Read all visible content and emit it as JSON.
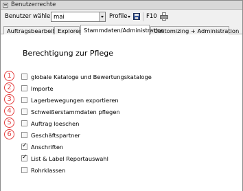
{
  "window": {
    "title": "Benutzerrechte"
  },
  "toolbar": {
    "user_label": "Benutzer wählen:",
    "user_value": "mai",
    "profile_label": "Profile",
    "f10_label": "F10"
  },
  "tabs": [
    {
      "label": "Auftragsbearbeitung",
      "active": false
    },
    {
      "label": "Explorer",
      "active": false
    },
    {
      "label": "Stammdaten/Administration",
      "active": true
    },
    {
      "label": "Customizing + Administration",
      "active": false
    }
  ],
  "section": {
    "title": "Berechtigung zur Pflege"
  },
  "annotations": [
    "1",
    "2",
    "3",
    "4",
    "5",
    "6"
  ],
  "permissions": [
    {
      "label": "globale Kataloge und Bewertungskataloge",
      "checked": false
    },
    {
      "label": "Importe",
      "checked": false
    },
    {
      "label": "Lagerbewegungen exportieren",
      "checked": false
    },
    {
      "label": "Schweißerstammdaten pflegen",
      "checked": false
    },
    {
      "label": "Auftrag loeschen",
      "checked": false
    },
    {
      "label": "Geschäftspartner",
      "checked": false
    },
    {
      "label": "Anschriften",
      "checked": true
    },
    {
      "label": "List & Label Reportauswahl",
      "checked": true
    },
    {
      "label": "Rohrklassen",
      "checked": false
    }
  ],
  "colors": {
    "annotation": "#e33b3b"
  }
}
